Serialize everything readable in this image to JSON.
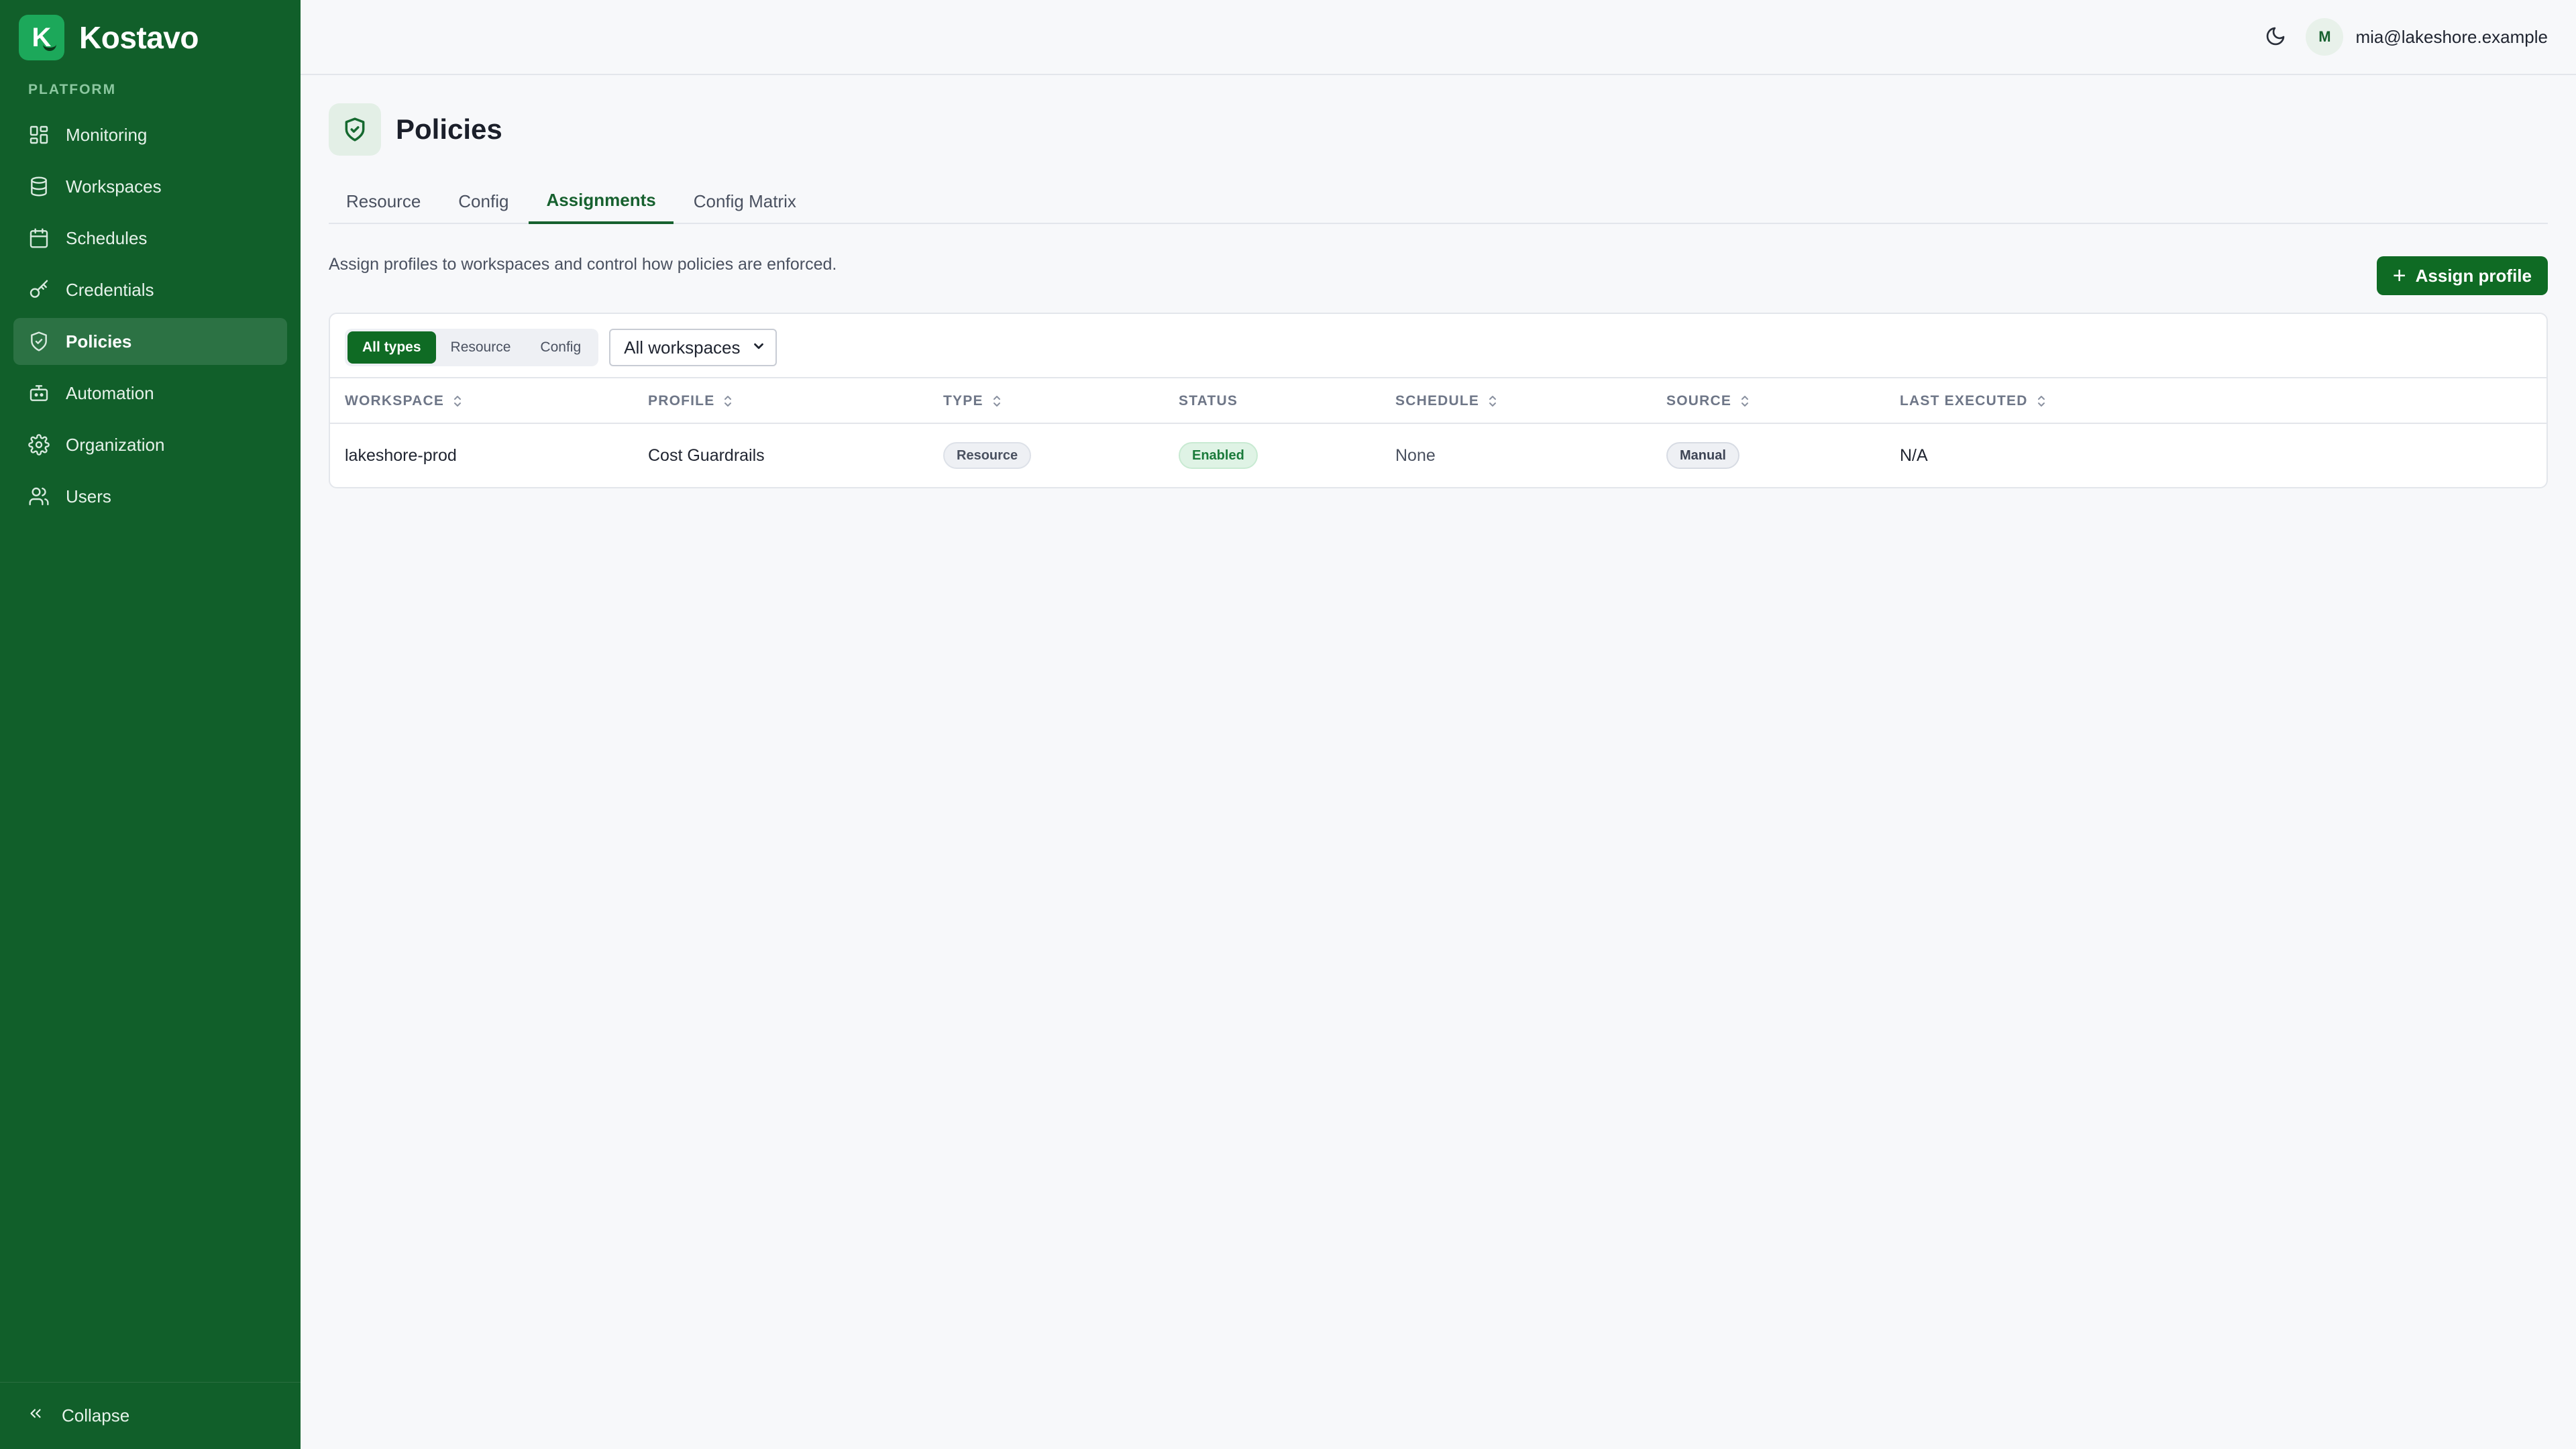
{
  "brand": {
    "name": "Kostavo",
    "logo_letter": "K"
  },
  "sidebar": {
    "section_label": "PLATFORM",
    "items": [
      {
        "label": "Monitoring",
        "icon": "dashboard-grid-icon"
      },
      {
        "label": "Workspaces",
        "icon": "database-icon"
      },
      {
        "label": "Schedules",
        "icon": "calendar-icon"
      },
      {
        "label": "Credentials",
        "icon": "key-icon"
      },
      {
        "label": "Policies",
        "icon": "shield-check-icon",
        "active": true
      },
      {
        "label": "Automation",
        "icon": "robot-icon"
      },
      {
        "label": "Organization",
        "icon": "gear-icon"
      },
      {
        "label": "Users",
        "icon": "users-icon"
      }
    ],
    "collapse_label": "Collapse"
  },
  "topbar": {
    "theme_icon": "moon-icon",
    "user": {
      "initial": "M",
      "email": "mia@lakeshore.example"
    }
  },
  "page": {
    "title": "Policies",
    "icon": "shield-check-icon",
    "tabs": [
      {
        "label": "Resource"
      },
      {
        "label": "Config"
      },
      {
        "label": "Assignments",
        "active": true
      },
      {
        "label": "Config Matrix"
      }
    ],
    "description": "Assign profiles to workspaces and control how policies are enforced.",
    "assign_button": "Assign profile"
  },
  "filters": {
    "type_options": [
      "All types",
      "Resource",
      "Config"
    ],
    "active_type": "All types",
    "workspace_select": "All workspaces"
  },
  "table": {
    "columns": [
      "WORKSPACE",
      "PROFILE",
      "TYPE",
      "STATUS",
      "SCHEDULE",
      "SOURCE",
      "LAST EXECUTED"
    ],
    "rows": [
      {
        "workspace": "lakeshore-prod",
        "profile": "Cost Guardrails",
        "type": "Resource",
        "status": "Enabled",
        "schedule": "None",
        "source": "Manual",
        "last_executed": "N/A"
      }
    ]
  },
  "colors": {
    "sidebar_bg": "#115f2a",
    "accent": "#0f6b24",
    "enabled_badge": "#dff3e5",
    "delete_action": "#d94444"
  }
}
